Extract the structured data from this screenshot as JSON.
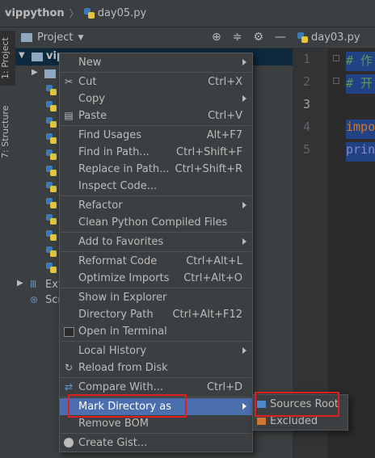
{
  "breadcrumb": {
    "project": "vippython",
    "file": "day05.py"
  },
  "side_tabs": {
    "project": "1: Project",
    "structure": "7: Structure"
  },
  "project_panel": {
    "title": "Project",
    "root_name": "vip",
    "ext_label": "Ext",
    "scr_label": "Scr"
  },
  "editor": {
    "tab": "day03.py",
    "line_numbers": [
      "1",
      "2",
      "3",
      "4",
      "5"
    ],
    "lines": [
      "# 作",
      "# 开",
      "",
      "impo",
      "prin"
    ]
  },
  "context_menu": {
    "new": "New",
    "cut": "Cut",
    "cut_sc": "Ctrl+X",
    "copy": "Copy",
    "paste": "Paste",
    "paste_sc": "Ctrl+V",
    "find_usages": "Find Usages",
    "find_usages_sc": "Alt+F7",
    "find_in_path": "Find in Path...",
    "find_in_path_sc": "Ctrl+Shift+F",
    "replace_in_path": "Replace in Path...",
    "replace_in_path_sc": "Ctrl+Shift+R",
    "inspect_code": "Inspect Code...",
    "refactor": "Refactor",
    "clean_python": "Clean Python Compiled Files",
    "add_favorites": "Add to Favorites",
    "reformat": "Reformat Code",
    "reformat_sc": "Ctrl+Alt+L",
    "optimize": "Optimize Imports",
    "optimize_sc": "Ctrl+Alt+O",
    "show_explorer": "Show in Explorer",
    "directory_path": "Directory Path",
    "directory_path_sc": "Ctrl+Alt+F12",
    "open_terminal": "Open in Terminal",
    "local_history": "Local History",
    "reload": "Reload from Disk",
    "compare": "Compare With...",
    "compare_sc": "Ctrl+D",
    "mark_directory": "Mark Directory as",
    "remove_bom": "Remove BOM",
    "create_gist": "Create Gist..."
  },
  "submenu": {
    "sources_root": "Sources Root",
    "excluded": "Excluded"
  },
  "colors": {
    "highlight": "#4b6eaf",
    "annotation": "#e02020",
    "sources_root": "#4a88c7",
    "excluded": "#cc7832"
  }
}
